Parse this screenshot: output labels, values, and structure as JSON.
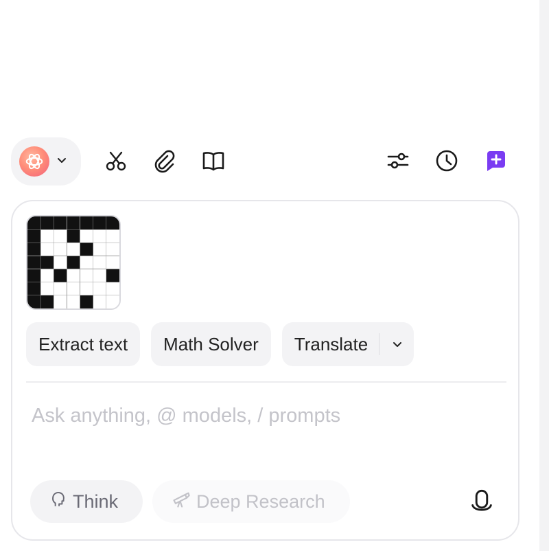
{
  "toolbar": {
    "model": {
      "icon": "openai-logo-icon",
      "caret_icon": "chevron-down-icon",
      "logo_color": "#f47a78"
    },
    "left_tools": [
      "scissors-icon",
      "paperclip-icon",
      "book-open-icon"
    ],
    "right_tools": [
      "sliders-icon",
      "clock-icon",
      "new-chat-icon"
    ],
    "accent": "#7a3cf2"
  },
  "attachment": {
    "type": "image",
    "description_icon": "crossword-grid-thumbnail"
  },
  "chips": [
    {
      "label": "Extract text"
    },
    {
      "label": "Math Solver"
    },
    {
      "label": "Translate",
      "dropdown_icon": "chevron-down-icon"
    }
  ],
  "input": {
    "placeholder": "Ask anything, @ models, / prompts",
    "value": ""
  },
  "bottom": {
    "think_label": "Think",
    "think_icon": "brain-icon",
    "deep_research_label": "Deep Research",
    "deep_research_icon": "telescope-icon",
    "mic_icon": "microphone-icon"
  }
}
